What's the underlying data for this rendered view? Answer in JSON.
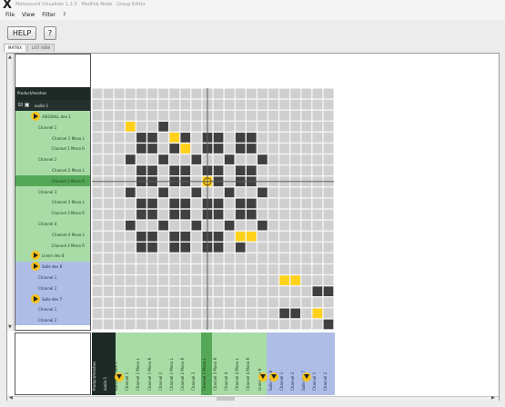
{
  "window": {
    "title": "Metasound Visualizer 1.2.3 · Medlink Node · Group Editor"
  },
  "menu": {
    "items": [
      "File",
      "View",
      "Filter",
      "?"
    ]
  },
  "toolbar": {
    "help_label": "HELP",
    "question_label": "?"
  },
  "tabs": [
    {
      "label": "MATRIX",
      "active": true
    },
    {
      "label": "LIST VIEW",
      "active": false
    }
  ],
  "tree": {
    "header": "Product/meshes",
    "root": "audio-1",
    "rows": [
      {
        "label": "ASIO4ALL dev 1",
        "level": 1,
        "badge": true,
        "band": "green"
      },
      {
        "label": "Channel 1",
        "level": 2,
        "band": "green"
      },
      {
        "label": "Channel 1 Mono L",
        "level": 3,
        "band": "green"
      },
      {
        "label": "Channel 1 Mono R",
        "level": 3,
        "band": "green"
      },
      {
        "label": "Channel 2",
        "level": 2,
        "band": "green"
      },
      {
        "label": "Channel 2 Mono L",
        "level": 3,
        "band": "green"
      },
      {
        "label": "Channel 2 Mono R",
        "level": 3,
        "band": "green",
        "selected": true
      },
      {
        "label": "Channel 3",
        "level": 2,
        "band": "green"
      },
      {
        "label": "Channel 3 Mono L",
        "level": 3,
        "band": "green"
      },
      {
        "label": "Channel 3 Mono R",
        "level": 3,
        "band": "green"
      },
      {
        "label": "Channel 4",
        "level": 2,
        "band": "green"
      },
      {
        "label": "Channel 4 Mono L",
        "level": 3,
        "band": "green"
      },
      {
        "label": "Channel 4 Mono R",
        "level": 3,
        "band": "green"
      },
      {
        "label": "Linein dev 8",
        "level": 1,
        "badge": true,
        "band": "green"
      },
      {
        "label": "Salle dev 8",
        "level": 1,
        "badge": true,
        "band": "blue"
      },
      {
        "label": "Channel 1",
        "level": 2,
        "band": "blue"
      },
      {
        "label": "Channel 2",
        "level": 2,
        "band": "blue"
      },
      {
        "label": "Salle dev 7",
        "level": 1,
        "badge": true,
        "band": "blue"
      },
      {
        "label": "Channel 1",
        "level": 2,
        "band": "blue"
      },
      {
        "label": "Channel 2",
        "level": 2,
        "band": "blue"
      }
    ]
  },
  "bottom_columns": [
    {
      "label": "Product/meshes",
      "band": "dark"
    },
    {
      "label": "audio-1",
      "band": "dark"
    },
    {
      "label": "ASIO4ALL dev 1",
      "band": "green",
      "badge": true
    },
    {
      "label": "Channel 1",
      "band": "green"
    },
    {
      "label": "Channel 1 Mono L",
      "band": "green"
    },
    {
      "label": "Channel 1 Mono R",
      "band": "green"
    },
    {
      "label": "Channel 2",
      "band": "green"
    },
    {
      "label": "Channel 2 Mono L",
      "band": "green"
    },
    {
      "label": "Channel 2 Mono R",
      "band": "green"
    },
    {
      "label": "Channel 3",
      "band": "green"
    },
    {
      "label": "Channel 3 Mono L",
      "band": "green",
      "selected": true
    },
    {
      "label": "Channel 3 Mono R",
      "band": "green"
    },
    {
      "label": "Channel 4",
      "band": "green"
    },
    {
      "label": "Channel 4 Mono L",
      "band": "green"
    },
    {
      "label": "Channel 4 Mono R",
      "band": "green"
    },
    {
      "label": "Linein dev 8",
      "band": "green",
      "badge": true
    },
    {
      "label": "Salle dev 8",
      "band": "blue",
      "badge": true
    },
    {
      "label": "Channel 1",
      "band": "blue"
    },
    {
      "label": "Channel 2",
      "band": "blue"
    },
    {
      "label": "Salle dev 7",
      "band": "blue",
      "badge": true
    },
    {
      "label": "Channel 1",
      "band": "blue"
    },
    {
      "label": "Channel 2",
      "band": "blue"
    }
  ],
  "matrix": {
    "size": 22,
    "dark_cells": [
      [
        3,
        6
      ],
      [
        4,
        4
      ],
      [
        4,
        5
      ],
      [
        4,
        7
      ],
      [
        4,
        8
      ],
      [
        4,
        10
      ],
      [
        4,
        11
      ],
      [
        4,
        13
      ],
      [
        4,
        14
      ],
      [
        5,
        4
      ],
      [
        5,
        5
      ],
      [
        5,
        7
      ],
      [
        5,
        10
      ],
      [
        5,
        11
      ],
      [
        5,
        13
      ],
      [
        5,
        14
      ],
      [
        6,
        3
      ],
      [
        6,
        6
      ],
      [
        6,
        9
      ],
      [
        6,
        12
      ],
      [
        6,
        15
      ],
      [
        7,
        4
      ],
      [
        7,
        5
      ],
      [
        7,
        7
      ],
      [
        7,
        8
      ],
      [
        7,
        10
      ],
      [
        7,
        11
      ],
      [
        7,
        13
      ],
      [
        7,
        14
      ],
      [
        8,
        4
      ],
      [
        8,
        5
      ],
      [
        8,
        7
      ],
      [
        8,
        8
      ],
      [
        8,
        11
      ],
      [
        8,
        13
      ],
      [
        8,
        14
      ],
      [
        9,
        3
      ],
      [
        9,
        6
      ],
      [
        9,
        9
      ],
      [
        9,
        12
      ],
      [
        9,
        15
      ],
      [
        10,
        4
      ],
      [
        10,
        5
      ],
      [
        10,
        7
      ],
      [
        10,
        8
      ],
      [
        10,
        10
      ],
      [
        10,
        11
      ],
      [
        10,
        13
      ],
      [
        10,
        14
      ],
      [
        11,
        4
      ],
      [
        11,
        5
      ],
      [
        11,
        7
      ],
      [
        11,
        8
      ],
      [
        11,
        10
      ],
      [
        11,
        11
      ],
      [
        11,
        13
      ],
      [
        11,
        14
      ],
      [
        12,
        3
      ],
      [
        12,
        6
      ],
      [
        12,
        9
      ],
      [
        12,
        12
      ],
      [
        12,
        15
      ],
      [
        13,
        4
      ],
      [
        13,
        5
      ],
      [
        13,
        7
      ],
      [
        13,
        8
      ],
      [
        13,
        10
      ],
      [
        13,
        11
      ],
      [
        13,
        13
      ],
      [
        14,
        4
      ],
      [
        14,
        5
      ],
      [
        14,
        7
      ],
      [
        14,
        8
      ],
      [
        14,
        10
      ],
      [
        14,
        11
      ],
      [
        14,
        13
      ],
      [
        18,
        20
      ],
      [
        18,
        21
      ],
      [
        20,
        17
      ],
      [
        20,
        18
      ],
      [
        21,
        21
      ]
    ],
    "yellow_cells": [
      [
        3,
        3
      ],
      [
        4,
        7
      ],
      [
        5,
        8
      ],
      [
        8,
        10
      ],
      [
        13,
        13
      ],
      [
        13,
        14
      ],
      [
        17,
        17
      ],
      [
        17,
        18
      ],
      [
        20,
        20
      ]
    ],
    "crosshair_row": 8,
    "crosshair_col": 10,
    "cursor_cell": [
      8,
      10
    ],
    "colors": {
      "cell": "#cfcfcf",
      "grid": "#f4f4f4",
      "dark": "#404040",
      "yellow": "#ffd11a",
      "crosshair": "#5f5f5f"
    }
  }
}
